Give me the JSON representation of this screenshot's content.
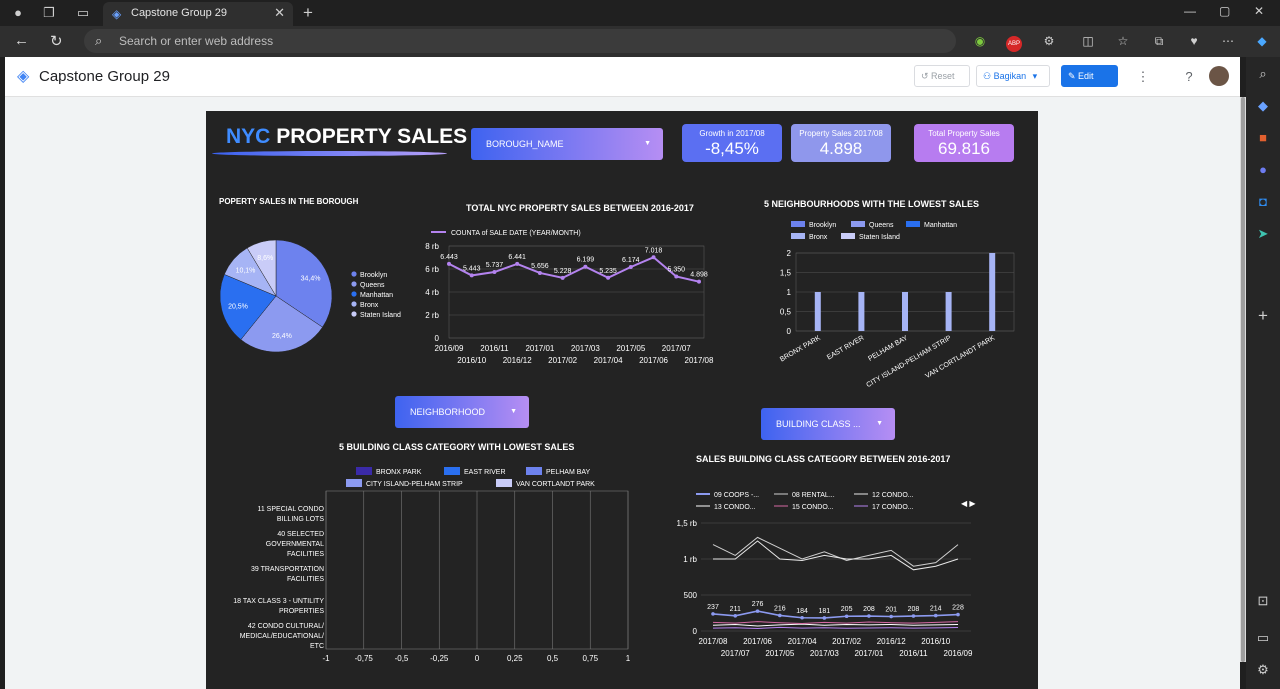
{
  "browser": {
    "tab_title": "Capstone Group 29",
    "address_placeholder": "Search or enter web address"
  },
  "looker_header": {
    "report_title": "Capstone Group 29",
    "reset_label": "Reset",
    "share_label": "Bagikan",
    "edit_label": "Edit"
  },
  "dashboard": {
    "title_part1": "NYC",
    "title_part2": "PROPERTY SALES",
    "filters": {
      "borough": "BOROUGH_NAME",
      "neighborhood": "NEIGHBORHOOD",
      "building_class": "BUILDING CLASS ..."
    },
    "kpis": [
      {
        "label": "Growth in 2017/08",
        "value": "-8,45%",
        "color": "#5b6ff2"
      },
      {
        "label": "Property Sales 2017/08",
        "value": "4.898",
        "color": "#8f97ec"
      },
      {
        "label": "Total Property Sales",
        "value": "69.816",
        "color": "#b77cf0"
      }
    ],
    "section_titles": {
      "pie": "POPERTY SALES IN THE BOROUGH",
      "line": "TOTAL NYC PROPERTY SALES BETWEEN 2016-2017",
      "neigh": "5 NEIGHBOURHOODS WITH THE LOWEST SALES",
      "bclass": "5 BUILDING CLASS CATEGORY WITH LOWEST SALES",
      "bclass_line": "SALES BUILDING CLASS CATEGORY BETWEEN 2016-2017"
    }
  },
  "chart_data": [
    {
      "type": "pie",
      "title": "POPERTY SALES IN THE BOROUGH",
      "labels": [
        "Brooklyn",
        "Queens",
        "Manhattan",
        "Bronx",
        "Staten Island"
      ],
      "values": [
        34.4,
        26.4,
        20.5,
        10.1,
        8.6
      ],
      "value_labels": [
        "34,4%",
        "26,4%",
        "20,5%",
        "10,1%",
        "8,6%"
      ],
      "colors": [
        "#6d82ee",
        "#8c9af0",
        "#2a6ff0",
        "#a6b4f5",
        "#c9ccf8"
      ],
      "legend": "right"
    },
    {
      "type": "line",
      "title": "TOTAL NYC PROPERTY SALES BETWEEN 2016-2017",
      "series_name": "COUNTA of SALE DATE (YEAR/MONTH)",
      "x": [
        "2016/09",
        "2016/10",
        "2016/11",
        "2016/12",
        "2017/01",
        "2017/02",
        "2017/03",
        "2017/04",
        "2017/05",
        "2017/06",
        "2017/07",
        "2017/08"
      ],
      "values": [
        6443,
        5443,
        5737,
        6441,
        5656,
        5228,
        6199,
        5235,
        6174,
        7018,
        5350,
        4898
      ],
      "value_labels": [
        "6.443",
        "5.443",
        "5.737",
        "6.441",
        "5.656",
        "5.228",
        "6.199",
        "5.235",
        "6.174",
        "7.018",
        "5.350",
        "4.898"
      ],
      "y_ticks": [
        "0",
        "2 rb",
        "4 rb",
        "6 rb",
        "8 rb"
      ],
      "ylim": [
        0,
        8000
      ],
      "color": "#b483ef",
      "grid": true
    },
    {
      "type": "bar",
      "title": "5 NEIGHBOURHOODS WITH THE LOWEST SALES",
      "categories": [
        "BRONX PARK",
        "EAST RIVER",
        "PELHAM BAY",
        "CITY ISLAND-PELHAM STRIP",
        "VAN CORTLANDT PARK"
      ],
      "values": [
        1,
        1,
        1,
        1,
        2
      ],
      "legend": [
        "Brooklyn",
        "Queens",
        "Manhattan",
        "Bronx",
        "Staten Island"
      ],
      "legend_colors": [
        "#6d82ee",
        "#8c9af0",
        "#2a6ff0",
        "#a6b4f5",
        "#c9ccf8"
      ],
      "y_ticks": [
        "0",
        "0,5",
        "1",
        "1,5",
        "2"
      ],
      "ylim": [
        0,
        2
      ],
      "bar_color": "#a6b4f5"
    },
    {
      "type": "bar",
      "title": "5 BUILDING CLASS CATEGORY WITH LOWEST SALES",
      "orientation": "horizontal",
      "categories": [
        "11 SPECIAL CONDO BILLING LOTS",
        "40 SELECTED GOVERNMENTAL FACILITIES",
        "39 TRANSPORTATION FACILITIES",
        "18 TAX CLASS 3 - UNTILITY PROPERTIES",
        "42 CONDO CULTURAL/ MEDICAL/EDUCATIONAL/ ETC"
      ],
      "series": [
        {
          "name": "BRONX PARK",
          "values": [
            0,
            0,
            0,
            0,
            0
          ]
        },
        {
          "name": "EAST RIVER",
          "values": [
            0,
            0,
            0,
            0,
            0
          ]
        },
        {
          "name": "PELHAM BAY",
          "values": [
            0,
            0,
            0,
            0,
            0
          ]
        },
        {
          "name": "CITY ISLAND-PELHAM STRIP",
          "values": [
            0,
            0,
            0,
            0,
            0
          ]
        },
        {
          "name": "VAN CORTLANDT PARK",
          "values": [
            0,
            0,
            0,
            0,
            0
          ]
        }
      ],
      "legend_colors": [
        "#3a2aa8",
        "#2a6ff0",
        "#6d82ee",
        "#8c9af0",
        "#c9ccf8"
      ],
      "x_ticks": [
        "-1",
        "-0,75",
        "-0,5",
        "-0,25",
        "0",
        "0,25",
        "0,5",
        "0,75",
        "1"
      ],
      "xlim": [
        -1,
        1
      ]
    },
    {
      "type": "line",
      "title": "SALES BUILDING CLASS CATEGORY BETWEEN 2016-2017",
      "x": [
        "2017/08",
        "2017/07",
        "2017/06",
        "2017/05",
        "2017/04",
        "2017/03",
        "2017/02",
        "2017/01",
        "2016/12",
        "2016/11",
        "2016/10",
        "2016/09"
      ],
      "series": [
        {
          "name": "09 COOPS -...",
          "values": [
            237,
            211,
            276,
            216,
            184,
            181,
            205,
            208,
            201,
            208,
            214,
            228
          ],
          "color": "#8c9af0"
        },
        {
          "name": "08 RENTAL...",
          "values": [
            1200,
            1050,
            1300,
            1150,
            1000,
            1100,
            980,
            1050,
            1120,
            900,
            950,
            1200
          ],
          "color": "#d0d0d0"
        },
        {
          "name": "12 CONDO...",
          "values": [
            1000,
            1000,
            1250,
            1000,
            980,
            1050,
            1000,
            1000,
            1050,
            850,
            900,
            1000
          ],
          "color": "#e8e8e8"
        },
        {
          "name": "13 CONDO...",
          "values": [
            80,
            90,
            70,
            85,
            95,
            80,
            90,
            85,
            90,
            80,
            85,
            90
          ],
          "color": "#ffffff"
        },
        {
          "name": "15 CONDO...",
          "values": [
            120,
            110,
            130,
            115,
            105,
            120,
            110,
            125,
            115,
            110,
            120,
            130
          ],
          "color": "#d46aa3"
        },
        {
          "name": "17 CONDO...",
          "values": [
            40,
            45,
            35,
            50,
            40,
            45,
            38,
            42,
            46,
            40,
            44,
            48
          ],
          "color": "#b483ef"
        }
      ],
      "value_labels": [
        "237",
        "211",
        "276",
        "216",
        "184",
        "181",
        "205",
        "208",
        "201",
        "208",
        "214",
        "228"
      ],
      "y_ticks": [
        "0",
        "500",
        "1 rb",
        "1,5 rb"
      ],
      "ylim": [
        0,
        1500
      ],
      "legend_pager": "◀ ▶"
    }
  ]
}
